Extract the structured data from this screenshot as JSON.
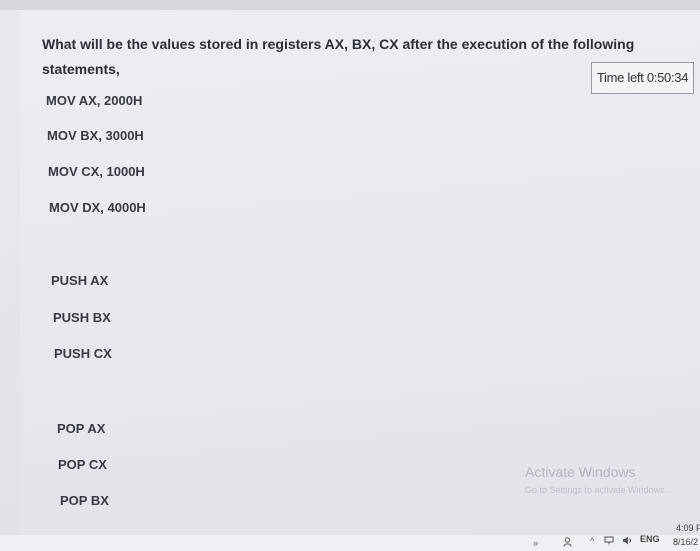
{
  "question": {
    "text": "What will be the values stored in registers AX, BX, CX after the execution of the following statements,"
  },
  "timer": {
    "label": "Time left 0:50:34"
  },
  "statements": [
    "MOV AX, 2000H",
    "MOV BX, 3000H",
    "MOV CX, 1000H",
    "MOV DX, 4000H",
    "PUSH AX",
    "PUSH BX",
    "PUSH CX",
    "POP AX",
    "POP CX",
    "POP BX"
  ],
  "watermark": {
    "title": "Activate Windows",
    "subtitle": "Go to Settings to activate Windows."
  },
  "taskbar": {
    "language": "ENG",
    "time": "4:09 P",
    "date": "8/16/2",
    "icons": [
      "chevron-right-icon",
      "person-icon",
      "chevron-up-icon",
      "network-icon",
      "volume-icon"
    ]
  }
}
